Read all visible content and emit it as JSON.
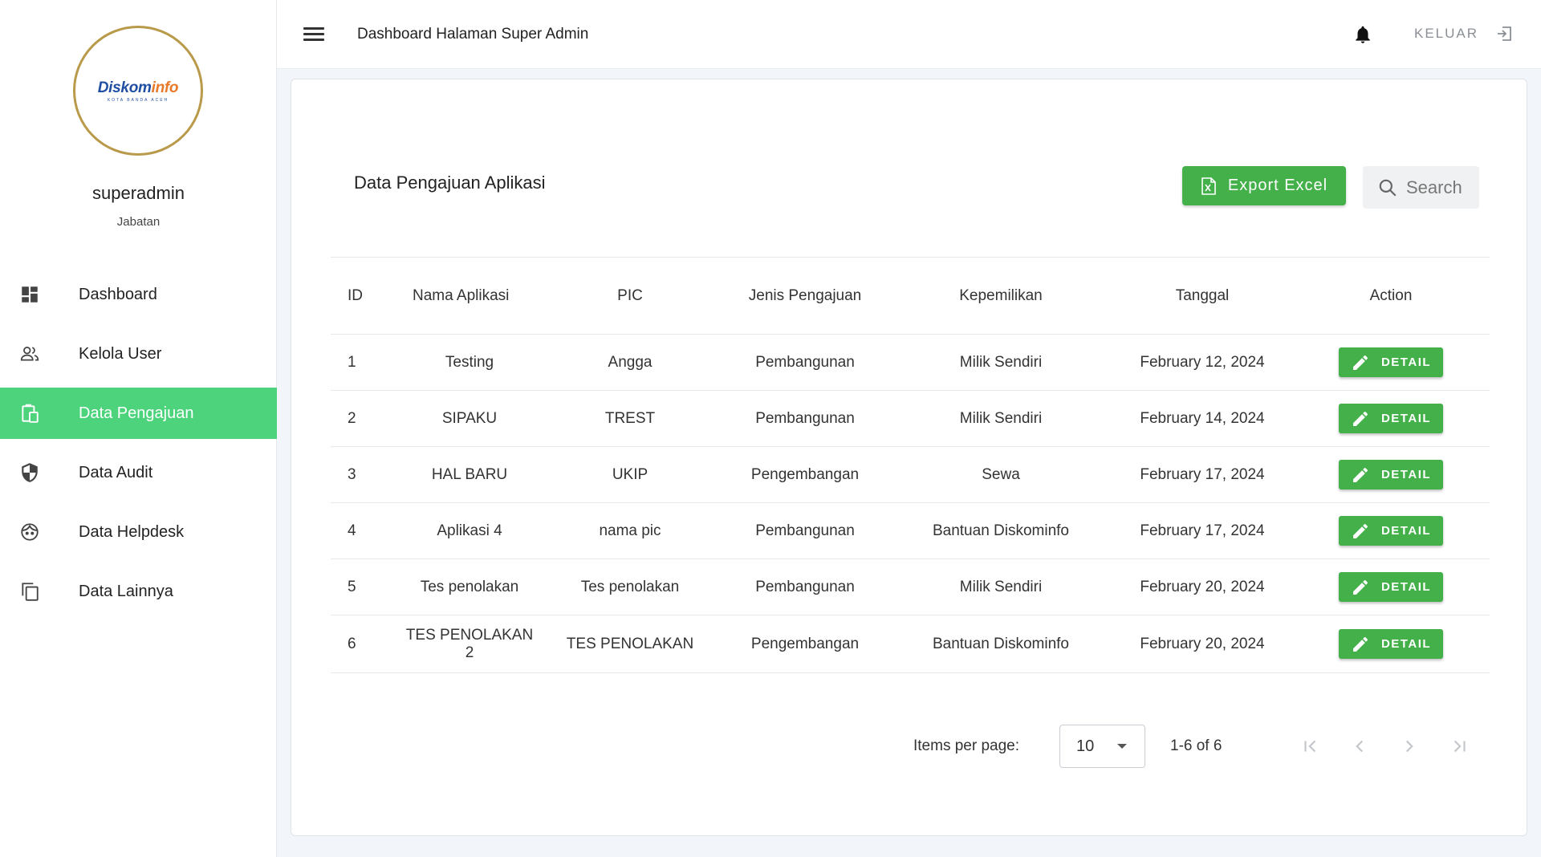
{
  "sidebar": {
    "logo": {
      "brand_a": "Diskom",
      "brand_b": "info",
      "sub": "KOTA BANDA ACEH"
    },
    "user_name": "superadmin",
    "user_role": "Jabatan",
    "items": [
      {
        "label": "Dashboard",
        "icon": "dashboard-icon"
      },
      {
        "label": "Kelola User",
        "icon": "users-icon"
      },
      {
        "label": "Data Pengajuan",
        "icon": "clipboard-icon",
        "active": true
      },
      {
        "label": "Data Audit",
        "icon": "shield-icon"
      },
      {
        "label": "Data Helpdesk",
        "icon": "face-icon"
      },
      {
        "label": "Data Lainnya",
        "icon": "copy-icon"
      }
    ]
  },
  "topbar": {
    "title": "Dashboard Halaman Super Admin",
    "logout_label": "KELUAR"
  },
  "main": {
    "title": "Data Pengajuan Aplikasi",
    "export_label": "Export Excel",
    "search_placeholder": "Search",
    "columns": [
      "ID",
      "Nama Aplikasi",
      "PIC",
      "Jenis Pengajuan",
      "Kepemilikan",
      "Tanggal",
      "Action"
    ],
    "rows": [
      {
        "id": "1",
        "nama": "Testing",
        "pic": "Angga",
        "jenis": "Pembangunan",
        "milik": "Milik Sendiri",
        "tanggal": "February 12, 2024",
        "action": "DETAIL"
      },
      {
        "id": "2",
        "nama": "SIPAKU",
        "pic": "TREST",
        "jenis": "Pembangunan",
        "milik": "Milik Sendiri",
        "tanggal": "February 14, 2024",
        "action": "DETAIL"
      },
      {
        "id": "3",
        "nama": "HAL BARU",
        "pic": "UKIP",
        "jenis": "Pengembangan",
        "milik": "Sewa",
        "tanggal": "February 17, 2024",
        "action": "DETAIL"
      },
      {
        "id": "4",
        "nama": "Aplikasi 4",
        "pic": "nama pic",
        "jenis": "Pembangunan",
        "milik": "Bantuan Diskominfo",
        "tanggal": "February 17, 2024",
        "action": "DETAIL"
      },
      {
        "id": "5",
        "nama": "Tes penolakan",
        "pic": "Tes penolakan",
        "jenis": "Pembangunan",
        "milik": "Milik Sendiri",
        "tanggal": "February 20, 2024",
        "action": "DETAIL"
      },
      {
        "id": "6",
        "nama": "TES PENOLAKAN 2",
        "pic": "TES PENOLAKAN",
        "jenis": "Pengembangan",
        "milik": "Bantuan Diskominfo",
        "tanggal": "February 20, 2024",
        "action": "DETAIL"
      }
    ],
    "pagination": {
      "label": "Items per page:",
      "per_page": "10",
      "range": "1-6 of 6"
    }
  },
  "colors": {
    "accent": "#4cd37c",
    "button_green": "#43b049",
    "logo_ring": "#b89a4a"
  }
}
